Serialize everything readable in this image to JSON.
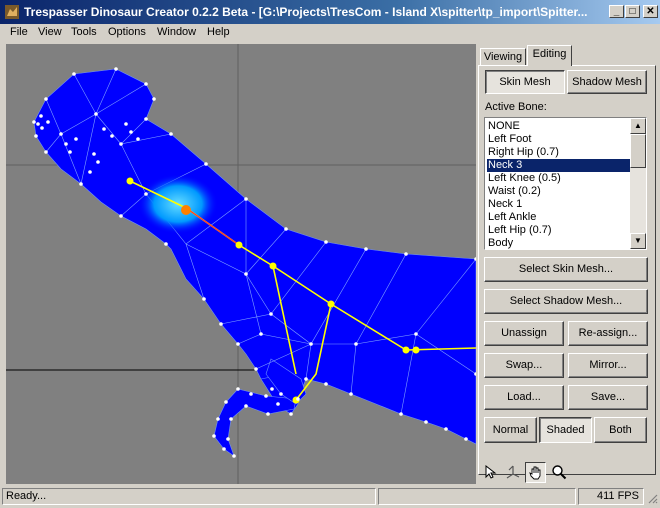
{
  "window": {
    "title": "Trespasser Dinosaur Creator 0.2.2 Beta - [G:\\Projects\\TresCom - Island X\\spitter\\tp_import\\Spitter...",
    "minimize": "_",
    "maximize": "□",
    "close": "✕"
  },
  "menu": [
    "File",
    "View",
    "Tools",
    "Options",
    "Window",
    "Help"
  ],
  "tabs": {
    "viewing": "Viewing",
    "editing": "Editing"
  },
  "mesh_buttons": {
    "skin": "Skin Mesh",
    "shadow": "Shadow Mesh"
  },
  "active_bone": {
    "label": "Active Bone:",
    "items": [
      "NONE",
      "Left Foot",
      "Right Hip (0.7)",
      "Neck 3",
      "Left Knee (0.5)",
      "Waist (0.2)",
      "Neck 1",
      "Left Ankle",
      "Left Hip (0.7)",
      "Body"
    ],
    "selected": "Neck 3"
  },
  "actions": {
    "select_skin": "Select Skin Mesh...",
    "select_shadow": "Select Shadow Mesh...",
    "unassign": "Unassign",
    "reassign": "Re-assign...",
    "swap": "Swap...",
    "mirror": "Mirror...",
    "load": "Load...",
    "save": "Save..."
  },
  "render_modes": {
    "normal": "Normal",
    "shaded": "Shaded",
    "both": "Both"
  },
  "tools": [
    "pointer-icon",
    "axis-icon",
    "hand-icon",
    "magnifier-icon"
  ],
  "status": {
    "message": "Ready...",
    "fps": "411 FPS"
  },
  "colors": {
    "mesh": "#0000ff",
    "highlight": "#00aaff",
    "bone": "#ffff00",
    "viewport_bg": "#808080",
    "selection": "#0a246a"
  }
}
